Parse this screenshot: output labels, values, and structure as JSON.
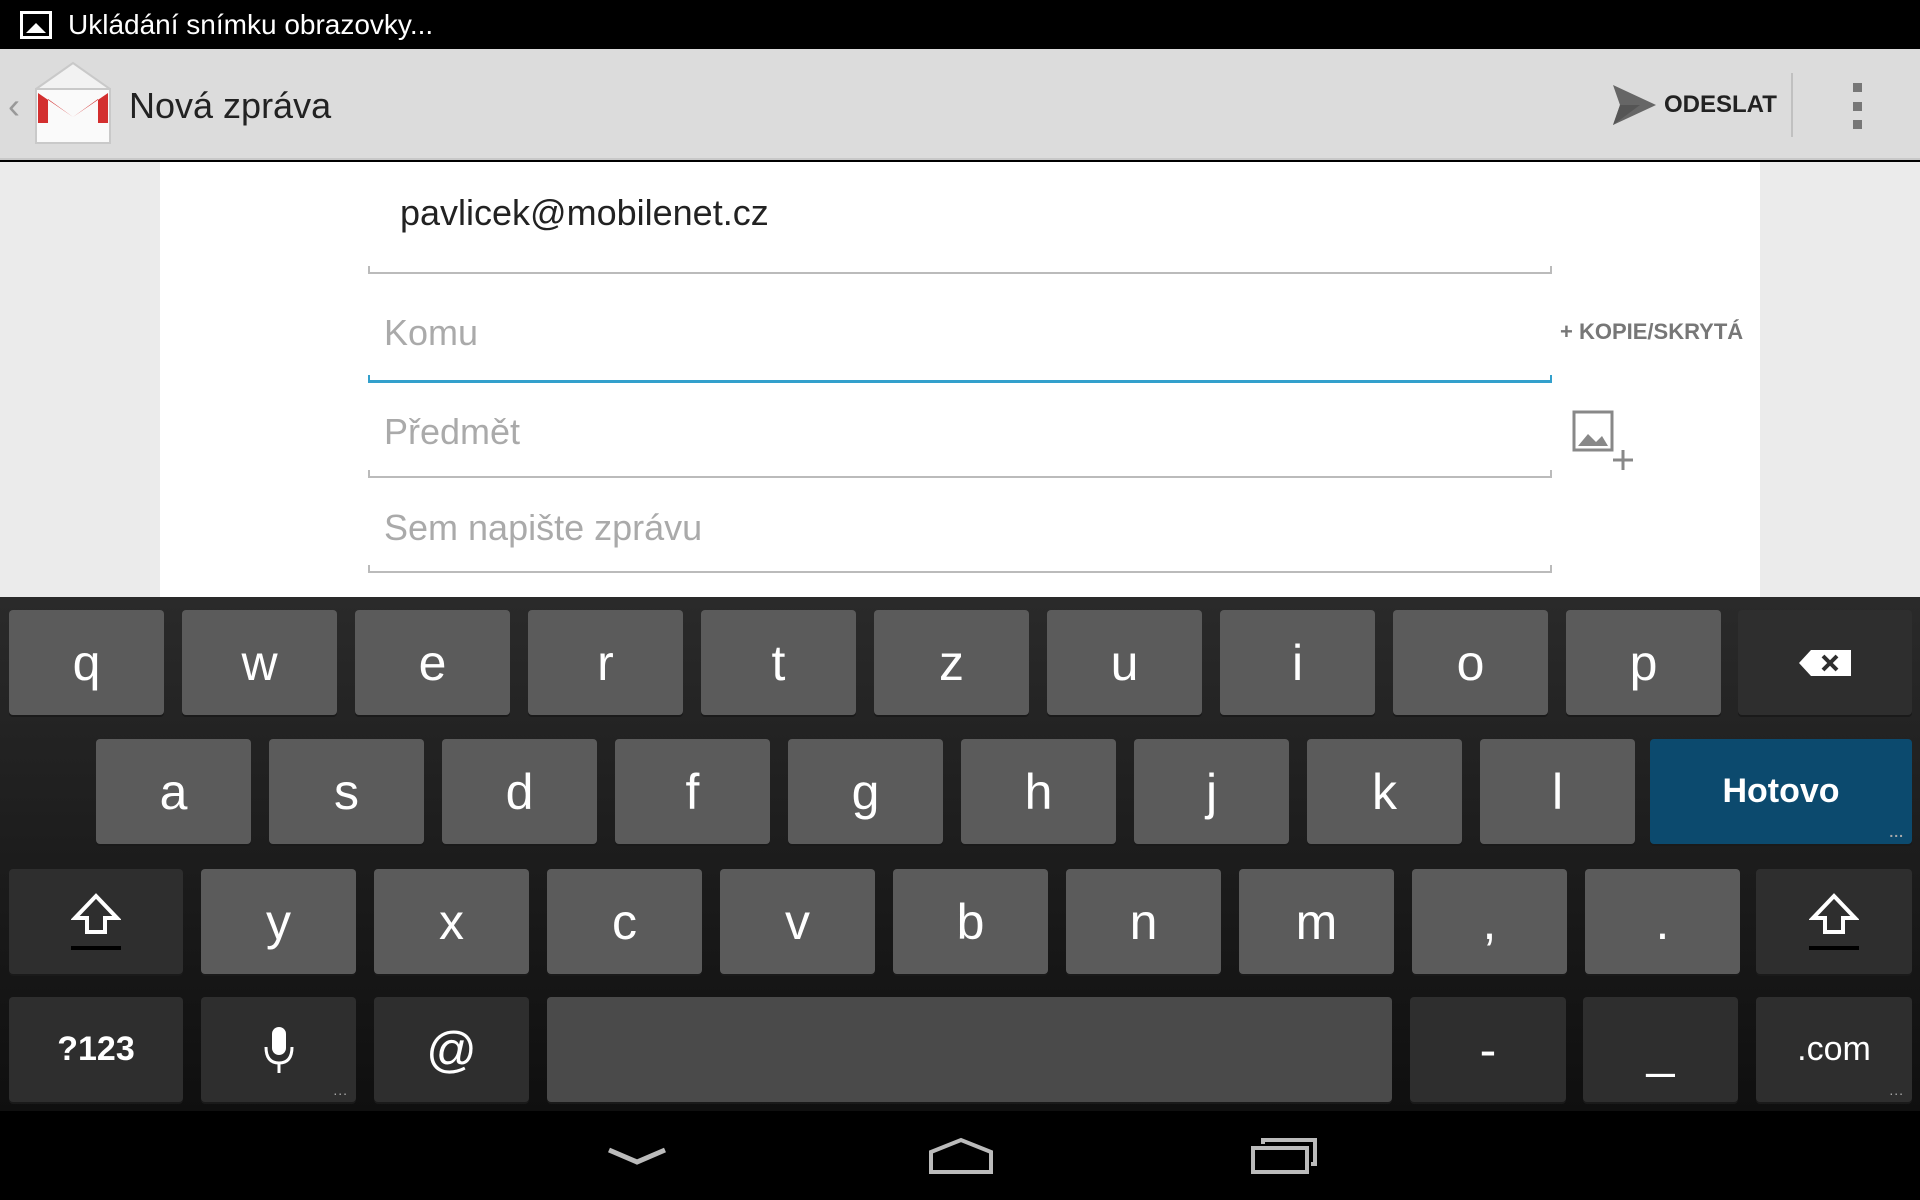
{
  "status_bar": {
    "notification_icon": "image-icon",
    "text": "Ukládání snímku obrazovky..."
  },
  "action_bar": {
    "up_icon": "chevron-left-icon",
    "app_icon": "gmail-icon",
    "title": "Nová zpráva",
    "send_icon": "send-icon",
    "send_label": "ODESLAT",
    "overflow_icon": "more-vert-icon"
  },
  "compose": {
    "from_value": "pavlicek@mobilenet.cz",
    "to_placeholder": "Komu",
    "cc_bcc_label": "+ KOPIE/SKRYTÁ",
    "subject_placeholder": "Předmět",
    "body_placeholder": "Sem napište zprávu",
    "attach_icon": "add-picture-icon"
  },
  "keyboard": {
    "row1": [
      "q",
      "w",
      "e",
      "r",
      "t",
      "z",
      "u",
      "i",
      "o",
      "p"
    ],
    "row2": [
      "a",
      "s",
      "d",
      "f",
      "g",
      "h",
      "j",
      "k",
      "l"
    ],
    "row3": [
      "y",
      "x",
      "c",
      "v",
      "b",
      "n",
      "m",
      ",",
      "."
    ],
    "backspace_icon": "backspace-icon",
    "action_label": "Hotovo",
    "shift_icon": "shift-icon",
    "symbols_label": "?123",
    "mic_icon": "microphone-icon",
    "at_label": "@",
    "space_label": "",
    "dash_label": "-",
    "underscore_label": "_",
    "dotcom_label": ".com",
    "more_hint": "..."
  },
  "nav_bar": {
    "back_icon": "back-icon",
    "home_icon": "home-icon",
    "recents_icon": "recent-apps-icon"
  },
  "colors": {
    "accent": "#33a0cc",
    "action_key": "#0c4a6e",
    "gmail_red": "#d32f2f"
  }
}
